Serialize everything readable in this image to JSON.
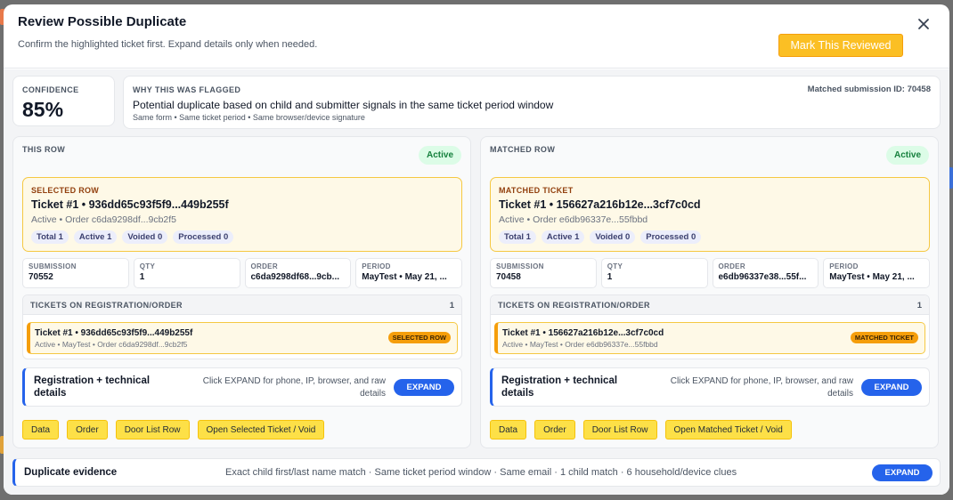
{
  "modal": {
    "title": "Review Possible Duplicate",
    "subtitle": "Confirm the highlighted ticket first. Expand details only when needed.",
    "primary_action": "Mark This Reviewed",
    "close_icon": "close-icon"
  },
  "confidence": {
    "label": "CONFIDENCE",
    "value": "85%"
  },
  "why": {
    "label": "WHY THIS WAS FLAGGED",
    "matched_id": "Matched submission ID: 70458",
    "text": "Potential duplicate based on child and submitter signals in the same ticket period window",
    "signals": "Same form • Same ticket period • Same browser/device signature"
  },
  "rows": [
    {
      "panel_label": "THIS ROW",
      "status": "Active",
      "card_label": "SELECTED ROW",
      "ticket_title": "Ticket #1 • 936dd65c93f5f9...449b255f",
      "ticket_meta": "Active • Order c6da9298df...9cb2f5",
      "chips": [
        "Total 1",
        "Active 1",
        "Voided 0",
        "Processed 0"
      ],
      "fields": [
        {
          "label": "SUBMISSION",
          "value": "70552"
        },
        {
          "label": "QTY",
          "value": "1"
        },
        {
          "label": "ORDER",
          "value": "c6da9298df68...9cb..."
        },
        {
          "label": "PERIOD",
          "value": "MayTest • May 21, ..."
        }
      ],
      "tickets_header": "TICKETS ON REGISTRATION/ORDER",
      "tickets_count": "1",
      "ticket_item_title": "Ticket #1 • 936dd65c93f5f9...449b255f",
      "ticket_item_meta": "Active • MayTest • Order c6da9298df...9cb2f5",
      "ticket_item_badge": "SELECTED ROW",
      "tech_title": "Registration + technical details",
      "tech_note": "Click EXPAND for phone, IP, browser, and raw details",
      "expand_label": "EXPAND",
      "actions": [
        "Data",
        "Order",
        "Door List Row",
        "Open Selected Ticket / Void"
      ]
    },
    {
      "panel_label": "MATCHED ROW",
      "status": "Active",
      "card_label": "MATCHED TICKET",
      "ticket_title": "Ticket #1 • 156627a216b12e...3cf7c0cd",
      "ticket_meta": "Active • Order e6db96337e...55fbbd",
      "chips": [
        "Total 1",
        "Active 1",
        "Voided 0",
        "Processed 0"
      ],
      "fields": [
        {
          "label": "SUBMISSION",
          "value": "70458"
        },
        {
          "label": "QTY",
          "value": "1"
        },
        {
          "label": "ORDER",
          "value": "e6db96337e38...55f..."
        },
        {
          "label": "PERIOD",
          "value": "MayTest • May 21, ..."
        }
      ],
      "tickets_header": "TICKETS ON REGISTRATION/ORDER",
      "tickets_count": "1",
      "ticket_item_title": "Ticket #1 • 156627a216b12e...3cf7c0cd",
      "ticket_item_meta": "Active • MayTest • Order e6db96337e...55fbbd",
      "ticket_item_badge": "MATCHED TICKET",
      "tech_title": "Registration + technical details",
      "tech_note": "Click EXPAND for phone, IP, browser, and raw details",
      "expand_label": "EXPAND",
      "actions": [
        "Data",
        "Order",
        "Door List Row",
        "Open Matched Ticket / Void"
      ]
    }
  ],
  "evidence": {
    "title": "Duplicate evidence",
    "text": "Exact child first/last name match · Same ticket period window · Same email · 1 child match · 6 household/device clues",
    "expand_label": "EXPAND"
  },
  "colors": {
    "accent": "#fbbf24",
    "link_blue": "#2563eb",
    "active_green": "#15803d",
    "highlight_bg": "#fef9e7"
  }
}
